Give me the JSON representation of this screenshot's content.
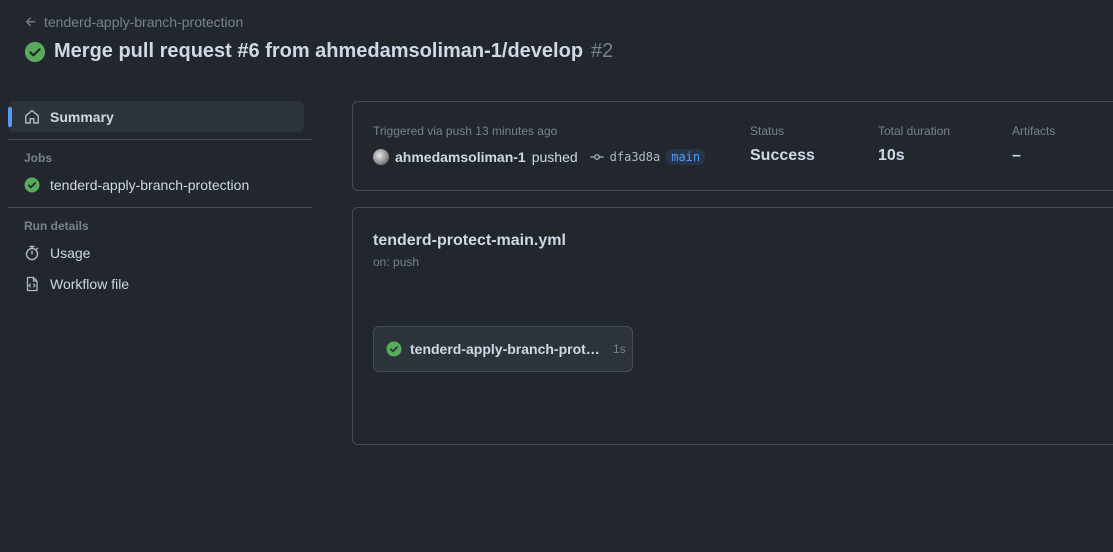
{
  "header": {
    "back_label": "tenderd-apply-branch-protection",
    "title": "Merge pull request #6 from ahmedamsoliman-1/develop",
    "run_number": "#2",
    "status_color": "#57ab5a"
  },
  "sidebar": {
    "summary_label": "Summary",
    "jobs_heading": "Jobs",
    "jobs": [
      {
        "label": "tenderd-apply-branch-protection",
        "status": "success"
      }
    ],
    "run_details_heading": "Run details",
    "usage_label": "Usage",
    "workflow_file_label": "Workflow file"
  },
  "summary": {
    "triggered": "Triggered via push 13 minutes ago",
    "actor": "ahmedamsoliman-1",
    "action": "pushed",
    "commit_sha": "dfa3d8a",
    "branch": "main",
    "status_label": "Status",
    "status_value": "Success",
    "duration_label": "Total duration",
    "duration_value": "10s",
    "artifacts_label": "Artifacts",
    "artifacts_value": "–"
  },
  "workflow": {
    "file": "tenderd-protect-main.yml",
    "trigger": "on: push",
    "job_name": "tenderd-apply-branch-protection",
    "job_duration": "1s"
  },
  "colors": {
    "accent": "#539bf5",
    "success": "#57ab5a",
    "background": "#22272e"
  }
}
